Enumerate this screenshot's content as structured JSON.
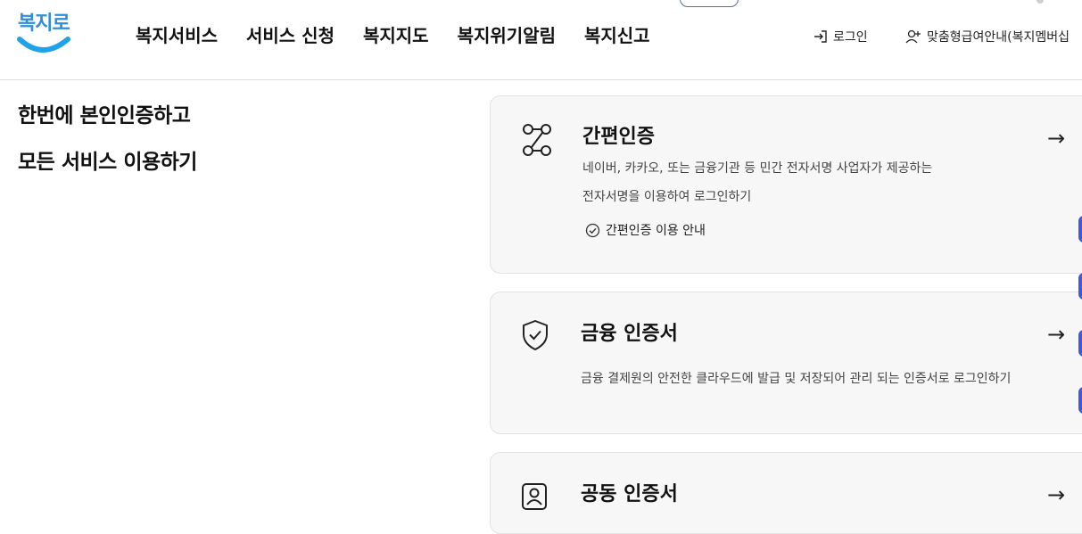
{
  "header": {
    "logo_text": "복지로",
    "nav": [
      "복지서비스",
      "서비스 신청",
      "복지지도",
      "복지위기알림",
      "복지신고"
    ],
    "login": "로그인",
    "custom_guide": "맞춤형급여안내(복지멤버십"
  },
  "intro": {
    "line1": "한번에 본인인증하고",
    "line2": "모든 서비스 이용하기"
  },
  "cards": [
    {
      "title": "간편인증",
      "desc_line1": "네이버, 카카오, 또는 금융기관 등 민간 전자서명 사업자가 제공하는",
      "desc_line2": "전자서명을 이용하여 로그인하기",
      "guide_link": "간편인증 이용 안내",
      "icon": "node-connect-icon",
      "arrow": "→"
    },
    {
      "title": "금융 인증서",
      "desc_line1": "금융 결제원의 안전한 클라우드에 발급 및 저장되어 관리 되는 인증서로 로그인하기",
      "icon": "shield-check-icon",
      "arrow": "→"
    },
    {
      "title": "공동 인증서",
      "icon": "user-certificate-icon",
      "arrow": "→"
    }
  ],
  "colors": {
    "brand_blue": "#2f8fd8",
    "smile_blue": "#1fa3e8",
    "side_dot": "#3d5bd9",
    "card_bg": "#f7f7f7"
  }
}
